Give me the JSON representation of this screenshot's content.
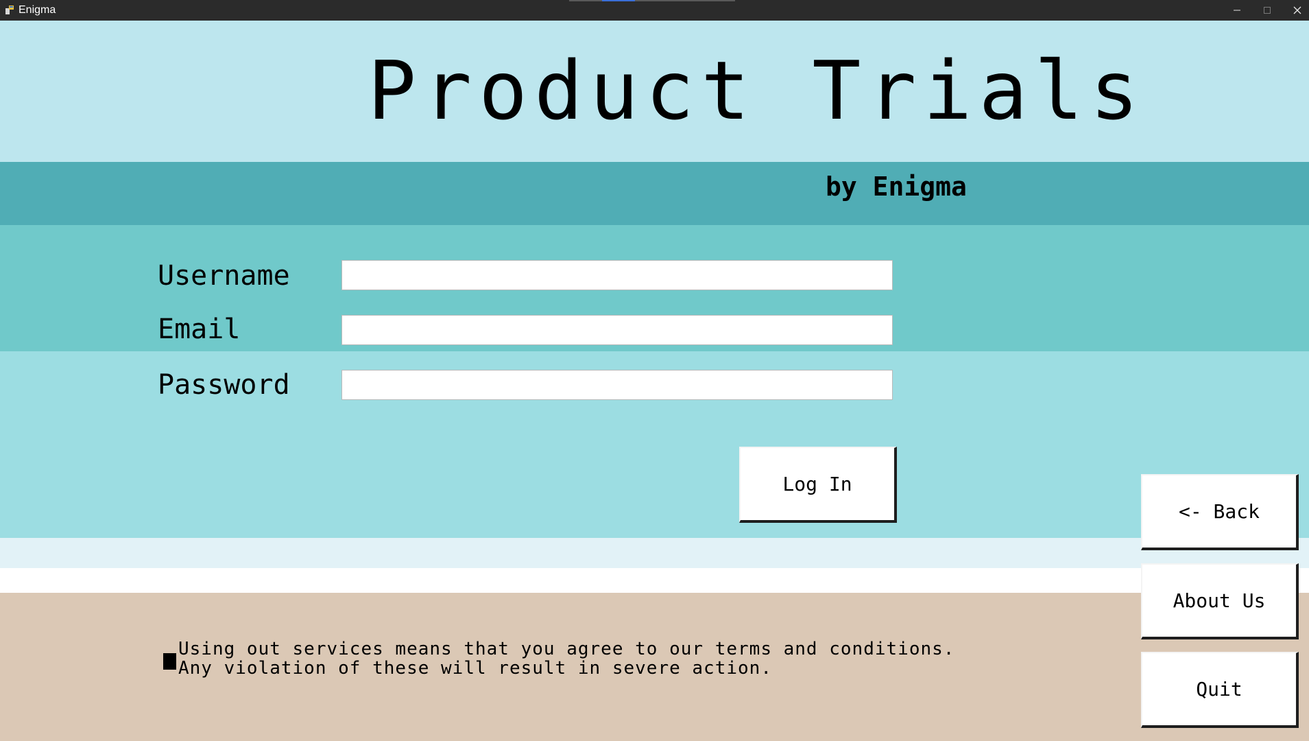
{
  "window": {
    "title": "Enigma",
    "icon": "app-icon",
    "controls": {
      "minimize_icon": "minimize-icon",
      "maximize_icon": "maximize-icon",
      "close_icon": "close-icon"
    }
  },
  "header": {
    "title": "Product Trials",
    "subtitle": "by Enigma"
  },
  "form": {
    "username_label": "Username",
    "username_value": "",
    "email_label": "Email",
    "email_value": "",
    "password_label": "Password",
    "password_value": "",
    "login_label": "Log In"
  },
  "side_buttons": {
    "back_label": "<- Back",
    "about_label": "About Us",
    "quit_label": "Quit"
  },
  "footer": {
    "terms_line1": "Using out services means that you agree to our terms and conditions.",
    "terms_line2": "Any violation of these will result in severe action."
  },
  "colors": {
    "title_band": "#bde6ee",
    "subtitle_band": "#50adb5",
    "form_band_a": "#70c9ca",
    "form_band_b": "#9cdde2",
    "light_band": "#e2f2f7",
    "footer_band": "#dbc8b5",
    "titlebar": "#2b2b2b"
  }
}
